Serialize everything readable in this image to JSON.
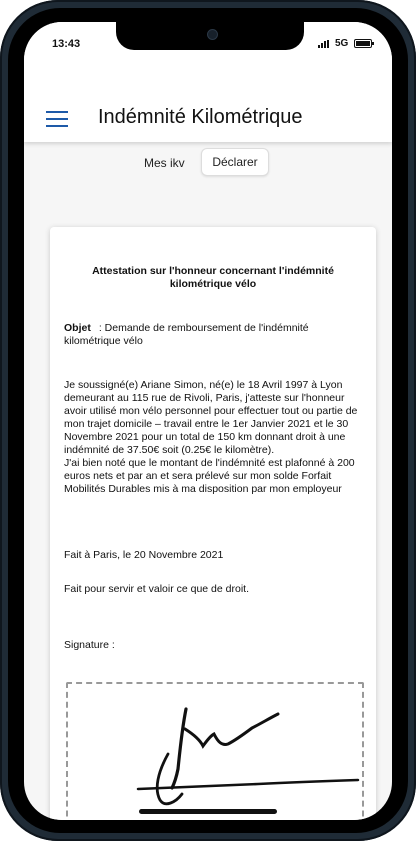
{
  "status_bar": {
    "time": "13:43",
    "network": "5G"
  },
  "app_bar": {
    "title": "Indémnité Kilométrique",
    "menu_icon": "hamburger-icon"
  },
  "tabs": {
    "mes_ikv": "Mes ikv",
    "declarer": "Déclarer"
  },
  "document": {
    "title": "Attestation sur l'honneur concernant l'indémnité kilométrique vélo",
    "objet_label": "Objet",
    "objet_text": ": Demande de remboursement de l'indémnité kilométrique vélo",
    "paragraph1": "Je soussigné(e) Ariane Simon, né(e) le 18 Avril 1997 à Lyon demeurant au 115 rue de Rivoli, Paris, j'atteste sur l'honneur avoir utilisé mon vélo personnel pour effectuer tout ou partie de mon trajet domicile – travail entre le 1er Janvier 2021 et le 30 Novembre 2021 pour un total de 150 km donnant droit à une indémnité de 37.50€ soit (0.25€ le kilomètre).",
    "paragraph2": "J'ai bien noté que le montant de l'indémnité est plafonné à 200 euros nets et par an et sera prélevé sur mon solde Forfait Mobilités Durables mis à ma disposition par mon employeur",
    "fait": "Fait à Paris, le 20 Novembre 2021",
    "valoir": "Fait pour servir et valoir ce que de droit.",
    "signature_label": "Signature :"
  }
}
